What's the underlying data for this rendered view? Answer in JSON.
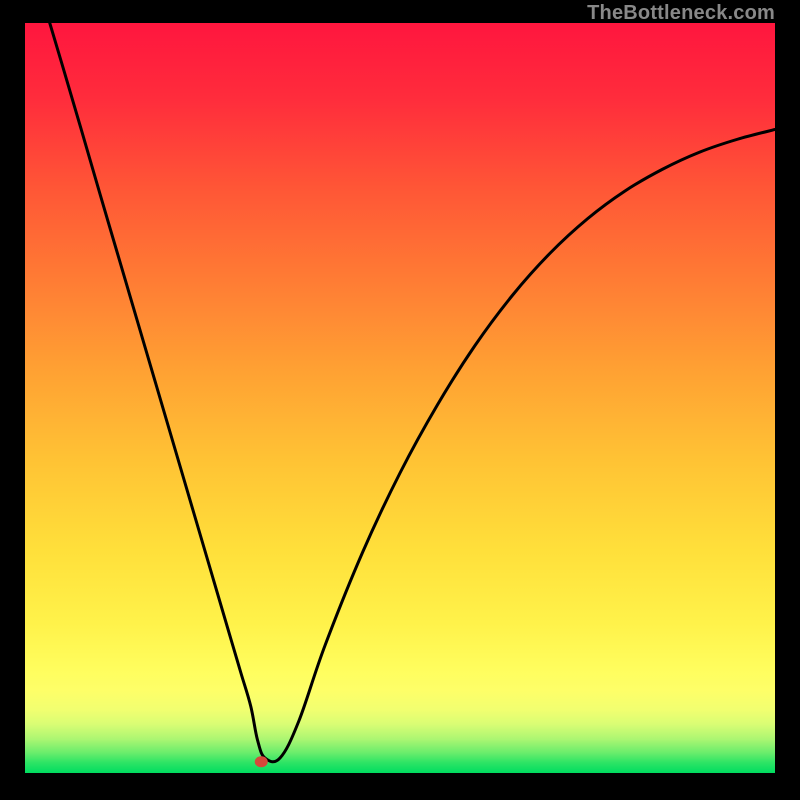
{
  "watermark": "TheBottleneck.com",
  "chart_data": {
    "type": "line",
    "title": "",
    "xlabel": "",
    "ylabel": "",
    "xlim": [
      0,
      100
    ],
    "ylim": [
      0,
      100
    ],
    "legend": false,
    "grid": false,
    "background_gradient": {
      "top": "#ff1a3a",
      "mid_band": "#fff95a",
      "bottom": "#00e060"
    },
    "series": [
      {
        "name": "bottleneck-curve",
        "color": "#000000",
        "x": [
          3.3,
          5,
          7.5,
          10,
          12.5,
          15,
          17.5,
          20,
          22.5,
          25,
          27.5,
          28.8,
          30.1,
          31,
          32,
          34,
          36.5,
          40,
          45,
          50,
          55,
          60,
          65,
          70,
          75,
          80,
          85,
          90,
          95,
          100
        ],
        "y": [
          100,
          94.3,
          85.8,
          77.2,
          68.7,
          60.2,
          51.7,
          43.2,
          34.7,
          26.2,
          17.7,
          13.3,
          8.9,
          4.4,
          2,
          2,
          6.9,
          17,
          29.4,
          40,
          49.1,
          57,
          63.7,
          69.3,
          73.9,
          77.6,
          80.5,
          82.8,
          84.5,
          85.8
        ]
      }
    ],
    "marker": {
      "name": "optimal-point",
      "x": 31.5,
      "y": 1.5,
      "color": "#d5493a",
      "rx": 6.5,
      "ry": 5.5
    }
  }
}
